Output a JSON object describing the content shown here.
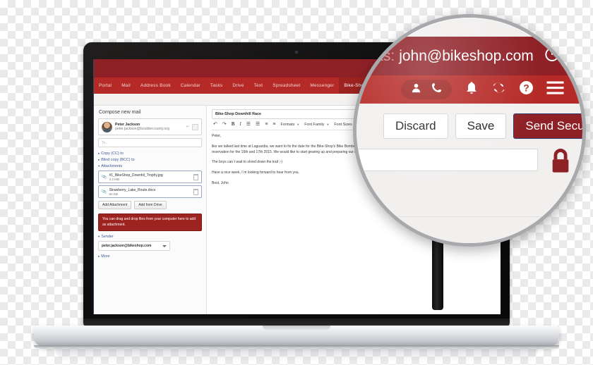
{
  "app": {
    "topbar": {
      "login_prefix": "in as:",
      "login_email": "john@bikeshop.com",
      "power_icon": "power-icon"
    },
    "nav": {
      "tabs": [
        {
          "label": "Portal"
        },
        {
          "label": "Mail"
        },
        {
          "label": "Address Book"
        },
        {
          "label": "Calendar"
        },
        {
          "label": "Tasks"
        },
        {
          "label": "Drive"
        },
        {
          "label": "Text"
        },
        {
          "label": "Spreadsheet"
        },
        {
          "label": "Messenger"
        }
      ],
      "active_tab": {
        "label": "Bike-Shop Downh...",
        "close": "×"
      },
      "icons": [
        {
          "name": "contact-icon"
        },
        {
          "name": "phone-icon"
        },
        {
          "name": "bell-icon"
        },
        {
          "name": "sync-icon"
        },
        {
          "name": "help-icon"
        },
        {
          "name": "menu-icon"
        }
      ]
    },
    "compose": {
      "title": "Compose new mail",
      "recipient": {
        "name": "Peter Jackson",
        "email": "peter.jackson@bouldercounty.org"
      },
      "recipient_input_placeholder": "To...",
      "links": {
        "cc": "Copy (CC) to",
        "bcc": "Blind copy (BCC) to",
        "attachments": "Attachments",
        "sender": "Sender",
        "more": "More"
      },
      "attachments": [
        {
          "name": "#1_BikeShop_Downhil_Trophy.jpg",
          "size": "3.2 MB"
        },
        {
          "name": "Strawberry_Lake_Route.docx",
          "size": "50 KB"
        }
      ],
      "buttons": {
        "add_attachment": "Add Attachment",
        "add_from_drive": "Add from Drive"
      },
      "dropzone": "You can drag and drop files from your computer here to add as attachment.",
      "sender_select": "peter.jackson@bikeshop.com"
    },
    "editor": {
      "subject": "Bike-Shop Downhill Race",
      "toolbar": {
        "undo": "↶",
        "redo": "↷",
        "bold": "B",
        "italic": "I",
        "bullet_list": "☰",
        "number_list": "☰",
        "outdent": "≡",
        "indent": "≡",
        "formats": "Formats",
        "font_family": "Font Family",
        "font_sizes": "Font Sizes"
      },
      "body": [
        "Peter,",
        "like we talked last time at Laguardia, we want to fix the date for the Bike-Shop's Bike Bomber and simply gorgeous mountains of yours. Would you please be so kind and confirm our reservation for the 16th and 17th 2015. We would like to start gearing up and preparing our racing team.",
        "The boys can´t wait to shred down the trail ;-)",
        "Have a nice week, I´m looking forward to hear from you.",
        "Best, John"
      ]
    },
    "actions": {
      "discard": "Discard",
      "save": "Save",
      "send_secure": "Send Secure",
      "lock_icon": "lock-icon"
    }
  },
  "colors": {
    "brand_dark_red": "#8e2026",
    "brand_red": "#b52a27",
    "active_tab_red": "#9d2320",
    "dropzone_red": "#9d2321",
    "link_blue": "#3b5998",
    "magnifier_ring": "#a7a9ac"
  }
}
